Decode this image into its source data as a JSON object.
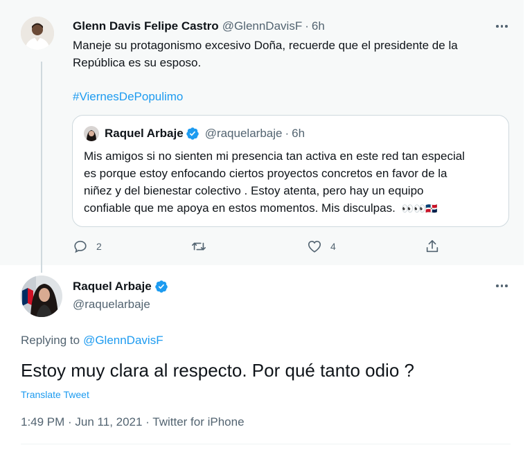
{
  "parent": {
    "author_name": "Glenn Davis Felipe Castro",
    "author_handle": "@GlennDavisF",
    "separator": "·",
    "time": "6h",
    "text_line1": "Maneje su protagonismo excesivo Doña, recuerde que el presidente de la",
    "text_line2": "República es su esposo.",
    "hashtag": "#ViernesDePopulimo",
    "quote": {
      "author_name": "Raquel Arbaje",
      "author_handle": "@raquelarbaje",
      "separator": "·",
      "time": "6h",
      "lines": [
        "Mis amigos si no sienten mi presencia tan activa en este red tan especial",
        "es porque estoy enfocando ciertos proyectos concretos en favor de la",
        "niñez y del bienestar colectivo . Estoy atenta, pero hay un equipo",
        "confiable que me apoya en estos momentos. Mis disculpas."
      ],
      "emoji": "👀👀🇩🇴"
    },
    "actions": {
      "reply_count": "2",
      "like_count": "4"
    }
  },
  "reply": {
    "author_name": "Raquel Arbaje",
    "author_handle": "@raquelarbaje",
    "replying_prefix": "Replying to",
    "replying_to": "@GlennDavisF",
    "text": "Estoy muy clara al respecto. Por qué tanto odio ?",
    "translate_label": "Translate Tweet",
    "timestamp": "1:49 PM · Jun 11, 2021 · Twitter for iPhone"
  },
  "colors": {
    "accent": "#1d9bf0",
    "secondary_text": "#536471",
    "parent_bg": "#f7f9f9"
  },
  "icons": [
    "more-icon",
    "verified-badge-icon",
    "reply-icon",
    "retweet-icon",
    "like-icon",
    "share-icon"
  ]
}
